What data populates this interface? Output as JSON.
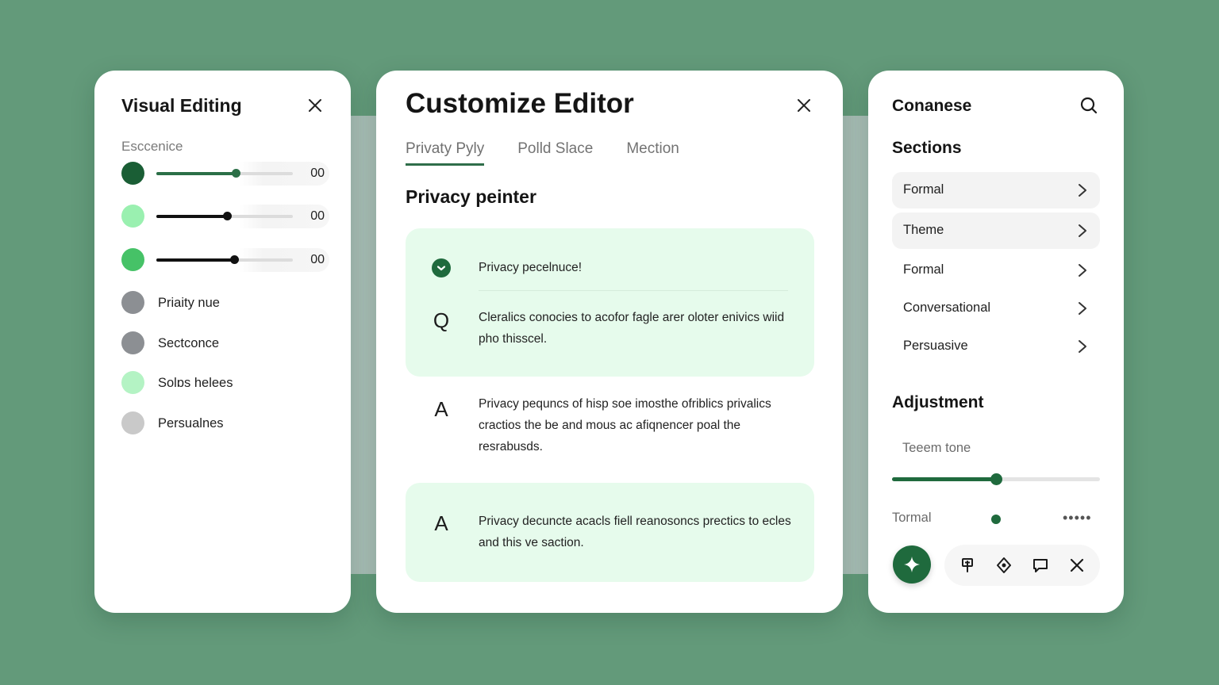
{
  "left_panel": {
    "title": "Visual Editing",
    "sublabel": "Esccenice",
    "sliders": [
      {
        "color": "#1a5e35",
        "fill_color": "#2b6f47",
        "value_label": "00",
        "level": 0.58
      },
      {
        "color": "#9af0b0",
        "fill_color": "#111111",
        "value_label": "00",
        "level": 0.52
      },
      {
        "color": "#46c267",
        "fill_color": "#111111",
        "value_label": "00",
        "level": 0.57
      }
    ],
    "items": [
      {
        "label": "Priaity nue",
        "color": "#8c8f93"
      },
      {
        "label": "Sectconce",
        "color": "#8c8f93"
      },
      {
        "label": "Solɒs helees",
        "color": "#b4f3c4"
      },
      {
        "label": "Persualnes",
        "color": "#c9c9c9"
      }
    ]
  },
  "center_panel": {
    "title": "Customize Editor",
    "tabs": [
      {
        "label": "Privaty Pyly",
        "active": true
      },
      {
        "label": "Polld Slace",
        "active": false
      },
      {
        "label": "Mection",
        "active": false
      }
    ],
    "section_title": "Privacy peinter",
    "items": [
      {
        "icon": "check-circle-icon",
        "text": "Privacy pecelnuce!"
      },
      {
        "icon": "letter-q-icon",
        "glyph": "Q",
        "text": "Cleralics conocies to acofor fagle arer oloter enivics wiid pho thisscel."
      },
      {
        "icon": "letter-a-icon",
        "glyph": "A",
        "text": "Privacy pequncs of hisp soe imosthe ofriblics privalics cractios the be and mous ac afiqnencer poal the resrabusds."
      },
      {
        "icon": "letter-a-icon",
        "glyph": "A",
        "text": "Privacy decuncte acacls fiell reanosoncs prectics to ecles and this ve saction."
      }
    ]
  },
  "right_panel": {
    "title": "Conanese",
    "sections_title": "Sections",
    "nav": [
      {
        "label": "Formal"
      },
      {
        "label": "Theme"
      },
      {
        "label": "Formal"
      },
      {
        "label": "Conversational"
      },
      {
        "label": "Persuasive"
      }
    ],
    "adjustment_title": "Adjustment",
    "tone_label": "Teeem tone",
    "tone_level": 0.5,
    "tormal_label": "Tormal",
    "more_label": "•••••",
    "accent": "#1f6a3d"
  }
}
